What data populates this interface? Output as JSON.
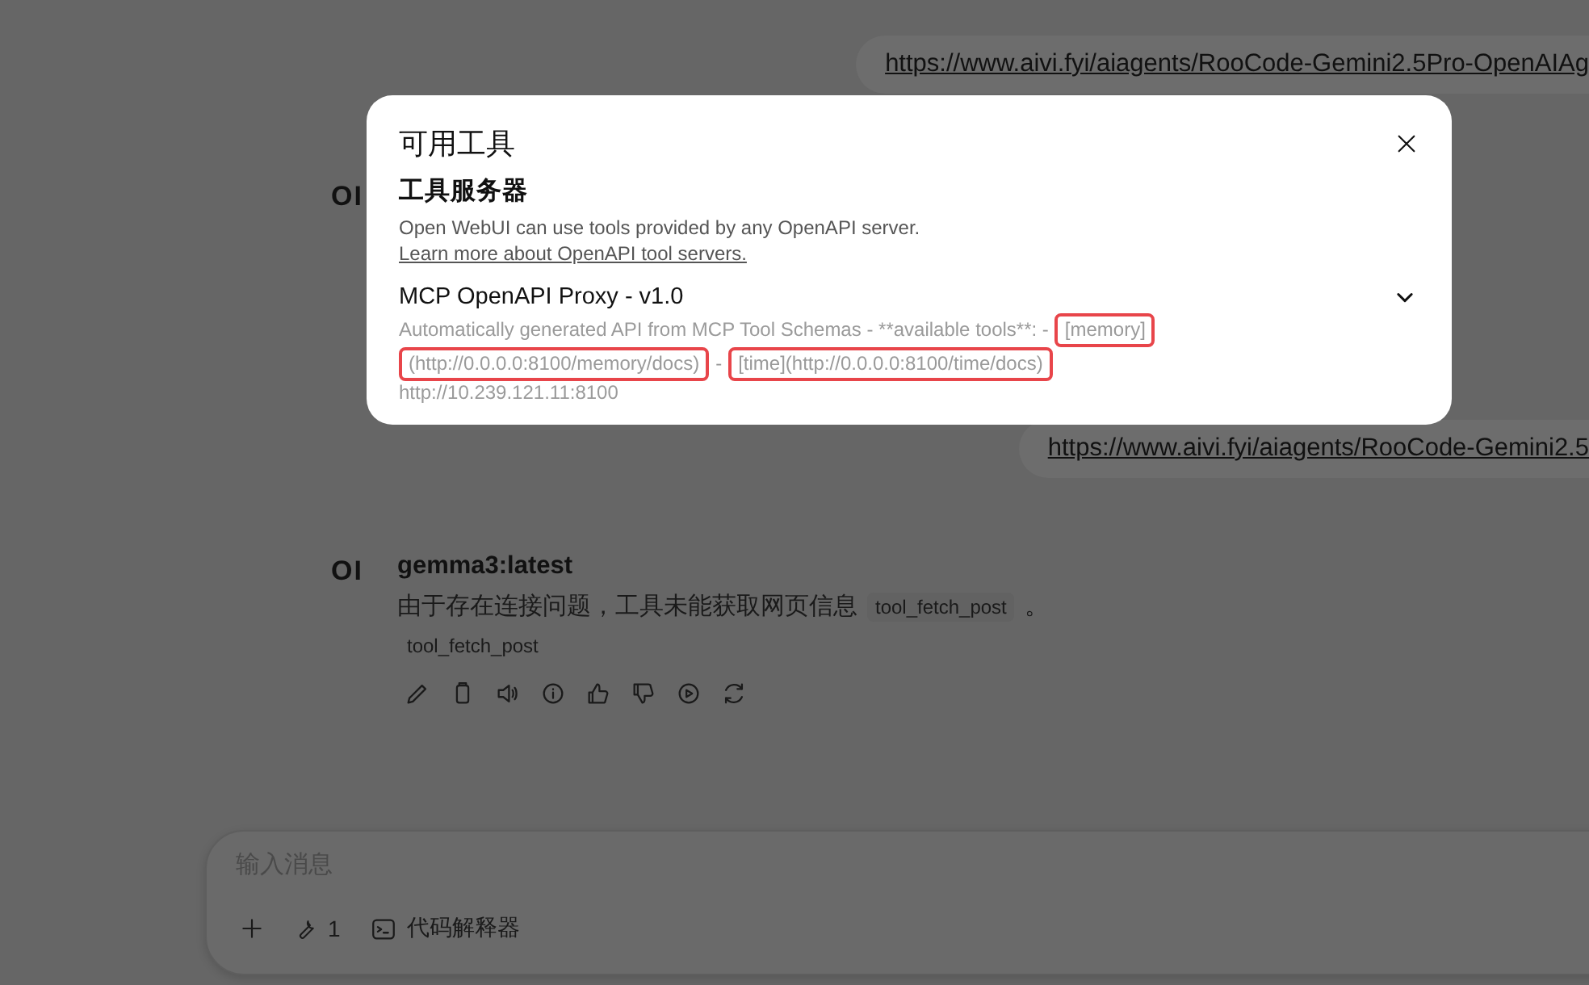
{
  "messages": [
    {
      "kind": "user",
      "link": "https://www.aivi.fyi/aiagents/RooCode-Gemini2.5Pro-OpenAIAg"
    },
    {
      "kind": "assistant",
      "logo": "OI"
    },
    {
      "kind": "user",
      "link": "https://www.aivi.fyi/aiagents/RooCode-Gemini2.5"
    },
    {
      "kind": "assistant",
      "logo": "OI",
      "model": "gemma3:latest",
      "text": "由于存在连接问题，工具未能获取网页信息",
      "code": "tool_fetch_post",
      "end": "。",
      "tool_chip": "tool_fetch_post"
    }
  ],
  "input": {
    "placeholder": "输入消息",
    "tool_count": "1",
    "code_interpreter": "代码解释器"
  },
  "modal": {
    "title": "可用工具",
    "section": "工具服务器",
    "description": "Open WebUI can use tools provided by any OpenAPI server.",
    "link": "Learn more about OpenAPI tool servers.",
    "servers": [
      {
        "name": "MCP OpenAPI Proxy - v1.0",
        "expanded": false,
        "url": "http://10.239.121.11:8100",
        "description_parts": [
          {
            "text": "Automatically generated API from MCP Tool Schemas - **available tools**: -",
            "highlighted": false
          },
          {
            "text": "[memory]",
            "highlighted": true
          },
          {
            "text": "(http://0.0.0.0:8100/memory/docs)",
            "highlighted": true
          },
          {
            "text": "-",
            "highlighted": false
          },
          {
            "text": "[time](http://0.0.0.0:8100/time/docs)",
            "highlighted": true
          }
        ]
      }
    ]
  }
}
